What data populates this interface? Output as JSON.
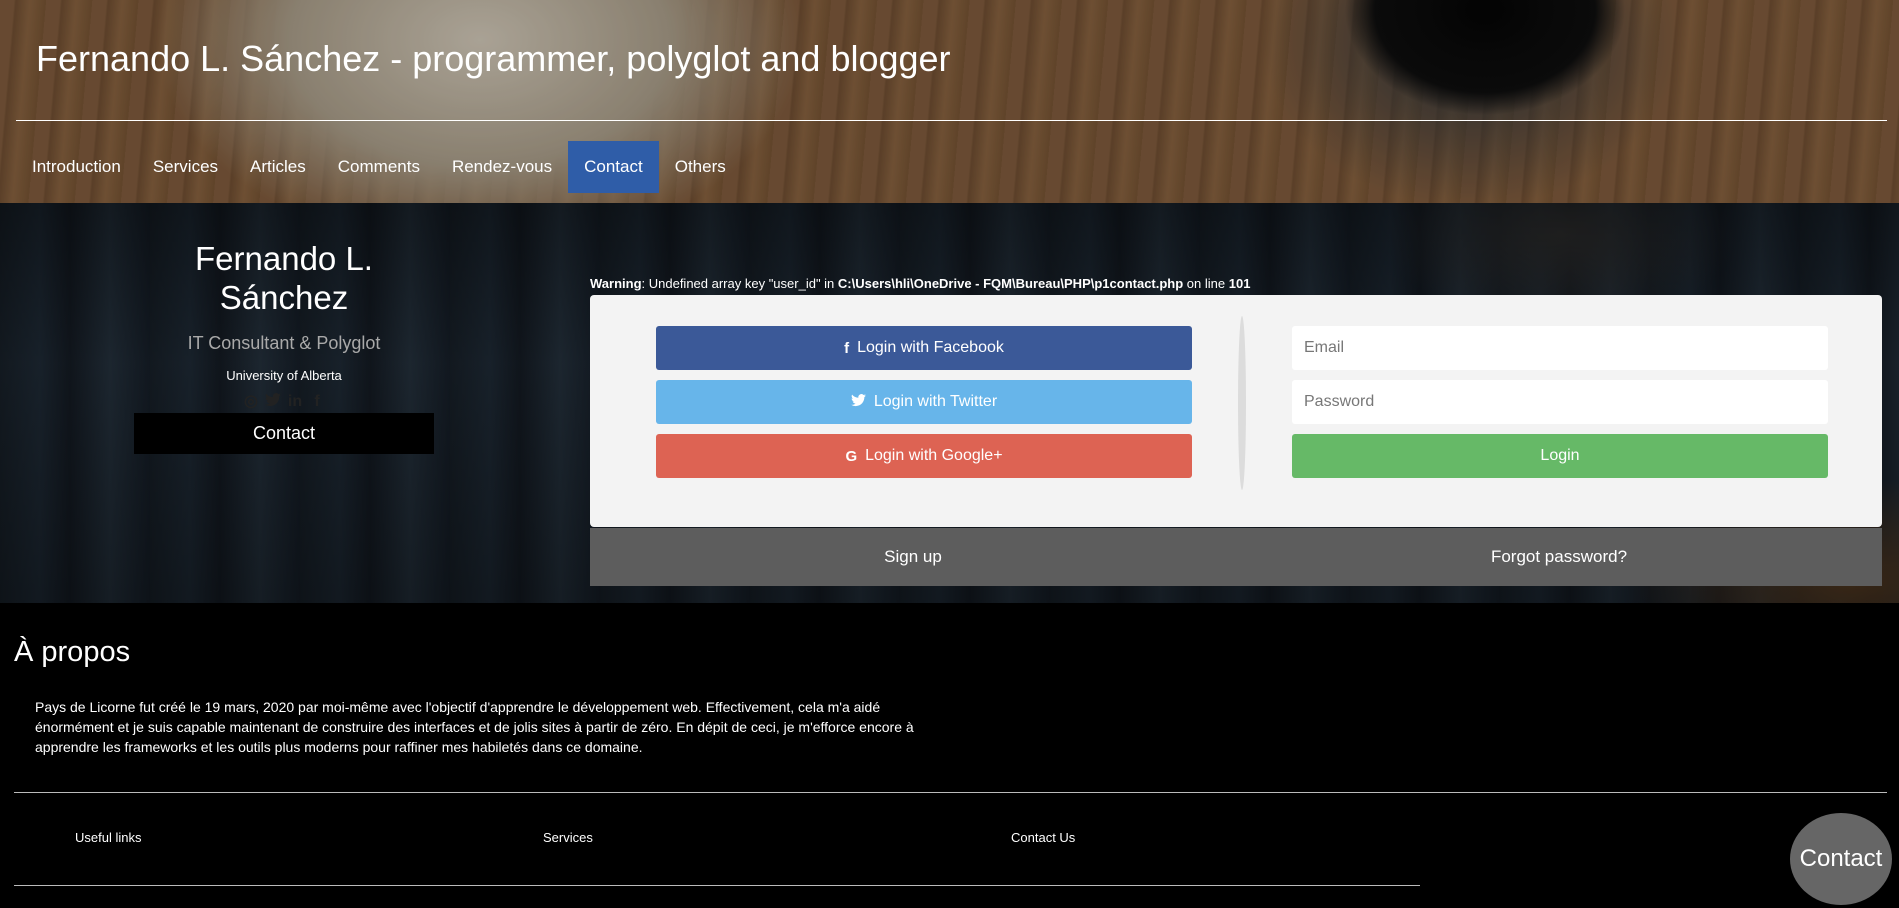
{
  "header": {
    "title": "Fernando L. Sánchez - programmer, polyglot and blogger",
    "nav": [
      {
        "label": "Introduction",
        "active": false
      },
      {
        "label": "Services",
        "active": false
      },
      {
        "label": "Articles",
        "active": false
      },
      {
        "label": "Comments",
        "active": false
      },
      {
        "label": "Rendez-vous",
        "active": false
      },
      {
        "label": "Contact",
        "active": true
      },
      {
        "label": "Others",
        "active": false
      }
    ]
  },
  "profile": {
    "name": "Fernando L. Sánchez",
    "role": "IT Consultant & Polyglot",
    "university": "University of Alberta",
    "social_icons": [
      "dribbble-icon",
      "twitter-icon",
      "linkedin-icon",
      "facebook-icon"
    ],
    "contact_label": "Contact"
  },
  "warning": {
    "label": "Warning",
    "text_1": ": Undefined array key \"user_id\" in ",
    "path": "C:\\Users\\hli\\OneDrive - FQM\\Bureau\\PHP\\p1contact.php",
    "text_2": " on line ",
    "line": "101"
  },
  "login": {
    "facebook_label": "Login with Facebook",
    "twitter_label": "Login with Twitter",
    "google_label": "Login with Google+",
    "email_placeholder": "Email",
    "password_placeholder": "Password",
    "login_label": "Login",
    "signup_label": "Sign up",
    "forgot_label": "Forgot password?",
    "colors": {
      "facebook": "#3b5998",
      "twitter": "#67b5ea",
      "google": "#dd6353",
      "login": "#66b967",
      "active_nav": "#2f5da8"
    }
  },
  "about": {
    "title": "À propos",
    "text": "Pays de Licorne fut créé le 19 mars, 2020 par moi-même avec l'objectif d'apprendre le développement web. Effectivement, cela m'a aidé énormément et je suis capable maintenant de construire des interfaces et de jolis sites à partir de zéro. En dépit de ceci, je m'efforce encore à apprendre les frameworks et les outils plus moderns pour raffiner mes habiletés dans ce domaine."
  },
  "footer": {
    "columns": [
      "Useful links",
      "Services",
      "Contact Us"
    ]
  },
  "floating_contact": "Contact"
}
